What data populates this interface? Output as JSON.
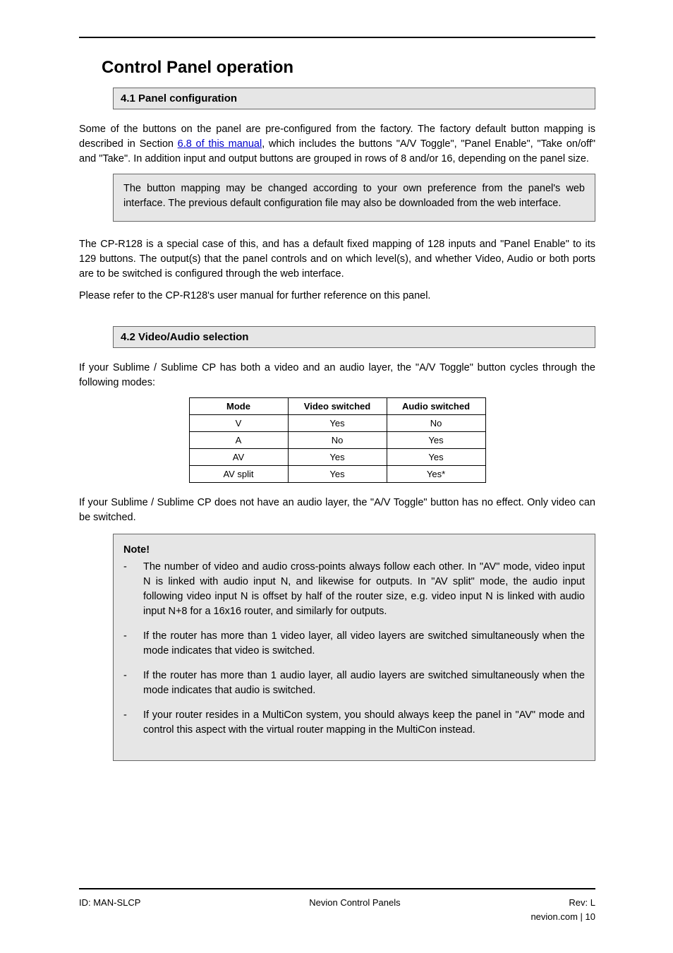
{
  "title": "Control Panel operation",
  "sub1": {
    "heading": "4.1 Panel configuration",
    "p1_a": "Some of the buttons on the panel are pre-configured from the factory. The factory default button mapping is described in Section ",
    "p1_link": "6.8 of this manual",
    "p1_b": ", which includes the buttons \"A/V Toggle\", \"Panel Enable\", \"Take on/off\" and \"Take\". In addition input and output buttons are grouped in rows of 8 and/or 16, depending on the panel size.",
    "note": "The button mapping may be changed according to your own preference from the panel's web interface. The previous default configuration file may also be downloaded from the web interface.",
    "p2": "The CP-R128 is a special case of this, and has a default fixed mapping of 128 inputs and \"Panel Enable\" to its 129 buttons. The output(s) that the panel controls and on which level(s), and whether Video, Audio or both ports are to be switched is configured through the web interface.",
    "p3": "Please refer to the CP-R128's user manual for further reference on this panel."
  },
  "sub2": {
    "heading": "4.2 Video/Audio selection",
    "p1": "If your Sublime / Sublime CP has both a video and an audio layer, the \"A/V Toggle\" button cycles through the following modes:",
    "table": {
      "headers": [
        "Mode",
        "Video switched",
        "Audio switched"
      ],
      "rows": [
        [
          "V",
          "Yes",
          "No"
        ],
        [
          "A",
          "No",
          "Yes"
        ],
        [
          "AV",
          "Yes",
          "Yes"
        ],
        [
          "AV split",
          "Yes",
          "Yes*"
        ]
      ]
    },
    "p2": "If your Sublime / Sublime CP does not have an audio layer, the \"A/V Toggle\" button has no effect. Only video can be switched.",
    "note_label": "Note!",
    "notes": [
      "The number of video and audio cross-points always follow each other. In \"AV\" mode, video input N is linked with audio input N, and likewise for outputs. In \"AV split\" mode, the audio input following video input N is offset by half of the router size, e.g. video input N is linked with audio input N+8 for a 16x16 router, and similarly for outputs.",
      "If the router has more than 1 video layer, all video layers are switched simultaneously when the mode indicates that video is switched.",
      "If the router has more than 1 audio layer, all audio layers are switched simultaneously when the mode indicates that audio is switched.",
      "If your router resides in a MultiCon system, you should always keep the panel in \"AV\" mode and control this aspect with the virtual router mapping in the MultiCon instead."
    ]
  },
  "footer": {
    "left": "ID: MAN-SLCP",
    "center": "Nevion Control Panels",
    "right_label": "Rev: ",
    "right_value": "L",
    "page": "nevion.com | 10"
  }
}
